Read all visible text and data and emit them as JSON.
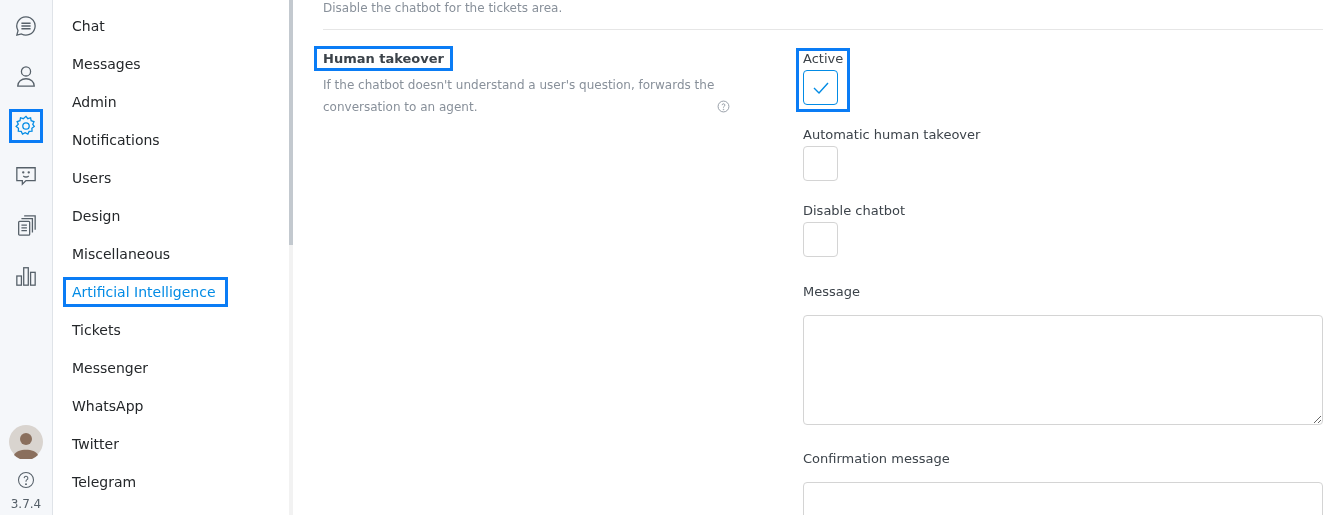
{
  "rail": {
    "items": [
      {
        "selected": false,
        "highlighted": false
      },
      {
        "selected": false,
        "highlighted": false
      },
      {
        "selected": true,
        "highlighted": true
      },
      {
        "selected": false,
        "highlighted": false
      },
      {
        "selected": false,
        "highlighted": false
      },
      {
        "selected": false,
        "highlighted": false
      }
    ],
    "version": "3.7.4"
  },
  "menu": {
    "items": [
      {
        "label": "Chat",
        "selected": false,
        "highlighted": false
      },
      {
        "label": "Messages",
        "selected": false,
        "highlighted": false
      },
      {
        "label": "Admin",
        "selected": false,
        "highlighted": false
      },
      {
        "label": "Notifications",
        "selected": false,
        "highlighted": false
      },
      {
        "label": "Users",
        "selected": false,
        "highlighted": false
      },
      {
        "label": "Design",
        "selected": false,
        "highlighted": false
      },
      {
        "label": "Miscellaneous",
        "selected": false,
        "highlighted": false
      },
      {
        "label": "Artificial Intelligence",
        "selected": true,
        "highlighted": true
      },
      {
        "label": "Tickets",
        "selected": false,
        "highlighted": false
      },
      {
        "label": "Messenger",
        "selected": false,
        "highlighted": false
      },
      {
        "label": "WhatsApp",
        "selected": false,
        "highlighted": false
      },
      {
        "label": "Twitter",
        "selected": false,
        "highlighted": false
      },
      {
        "label": "Telegram",
        "selected": false,
        "highlighted": false
      }
    ]
  },
  "previous_setting": {
    "description": "Disable the chatbot for the tickets area."
  },
  "setting": {
    "title": "Human takeover",
    "title_highlighted": true,
    "description": "If the chatbot doesn't understand a user's question, forwards the conversation to an agent.",
    "fields": [
      {
        "kind": "checkbox",
        "label": "Active",
        "checked": true,
        "highlighted": true
      },
      {
        "kind": "checkbox",
        "label": "Automatic human takeover",
        "checked": false,
        "highlighted": false
      },
      {
        "kind": "checkbox",
        "label": "Disable chatbot",
        "checked": false,
        "highlighted": false
      },
      {
        "kind": "textarea",
        "label": "Message"
      },
      {
        "kind": "textarea",
        "label": "Confirmation message"
      }
    ]
  }
}
